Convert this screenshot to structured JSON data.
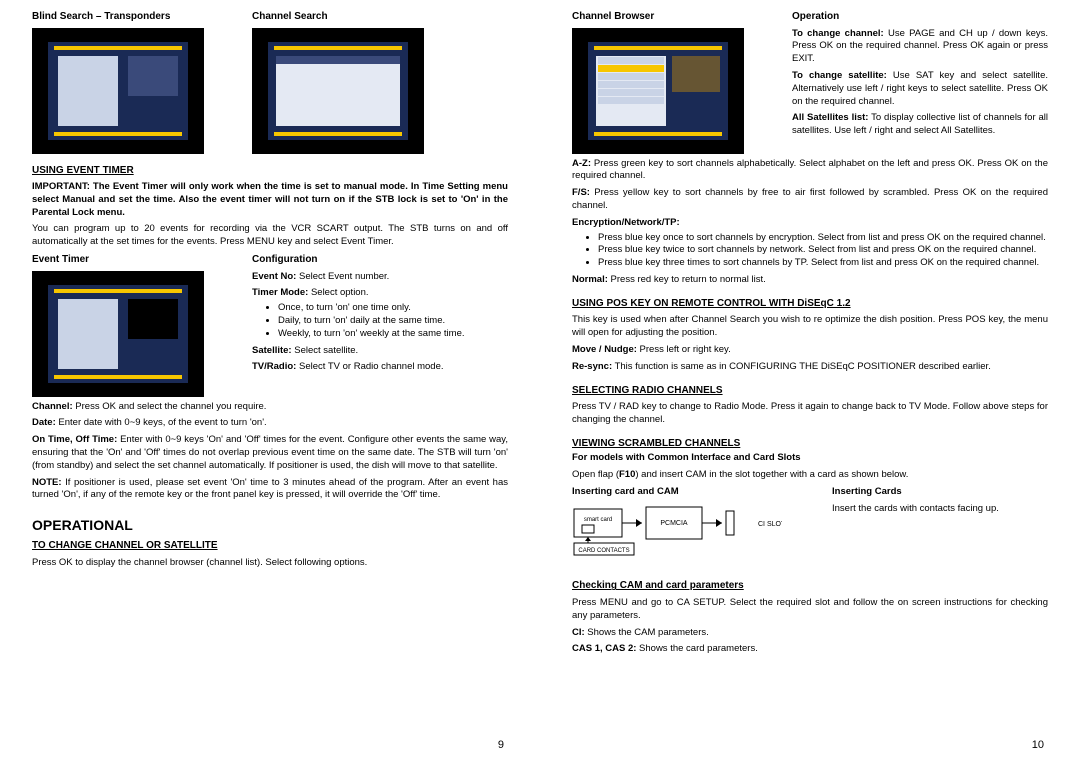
{
  "left": {
    "h_blind": "Blind Search – Transponders",
    "h_chsearch": "Channel Search",
    "using_event_timer": "USING EVENT TIMER",
    "important": "IMPORTANT: The Event Timer will only work when the time is set to manual mode. In Time Setting menu select Manual and set the time. Also the event timer will not turn on if the STB lock is set to 'On' in the Parental Lock menu.",
    "program_intro": "You can program up to 20 events for recording via the VCR SCART output. The STB turns on and off automatically at the set times for the events. Press MENU key and select Event Timer.",
    "h_event_timer": "Event Timer",
    "h_config": "Configuration",
    "cfg_event_no_b": "Event No:",
    "cfg_event_no": " Select Event number.",
    "cfg_timer_mode_b": "Timer Mode:",
    "cfg_timer_mode": " Select option.",
    "cfg_once": "Once, to turn 'on' one time only.",
    "cfg_daily": "Daily, to turn 'on' daily at the same time.",
    "cfg_weekly": "Weekly, to turn 'on' weekly at the same time.",
    "cfg_sat_b": "Satellite:",
    "cfg_sat": " Select satellite.",
    "cfg_tvr_b": "TV/Radio:",
    "cfg_tvr": " Select TV or Radio channel mode.",
    "channel_b": "Channel:",
    "channel": " Press OK and select the channel you require.",
    "date_b": "Date:",
    "date": " Enter date with 0~9 keys, of the event to turn 'on'.",
    "onoff_b": "On Time, Off Time:",
    "onoff": " Enter with 0~9 keys 'On' and 'Off' times for the event. Configure other events the same way, ensuring that the 'On' and 'Off' times do not overlap previous event time on the same date. The STB will turn 'on' (from standby) and select the set channel automatically. If positioner is used, the dish will move to that satellite.",
    "note_b": "NOTE:",
    "note": " If positioner is used, please set event 'On' time to 3 minutes ahead of the program. After an event has turned 'On', if any of the remote key or the front panel key is pressed, it will override the 'Off' time.",
    "operational": "OPERATIONAL",
    "to_change_h": "TO CHANGE CHANNEL OR SATELLITE",
    "to_change": "Press OK to display the channel browser (channel list). Select following options.",
    "page": "9"
  },
  "right": {
    "h_browser": "Channel Browser",
    "h_operation": "Operation",
    "op_change_ch_b": "To change channel:",
    "op_change_ch": " Use PAGE and CH up / down keys. Press OK on the required channel. Press OK again or press EXIT.",
    "op_change_sat_b": "To change satellite:",
    "op_change_sat": " Use SAT key and select satellite. Alternatively use left / right keys to select satellite. Press OK on the required channel.",
    "op_allsat_b": "All Satellites list:",
    "op_allsat": " To display collective list of channels for all satellites. Use left / right and select All Satellites.",
    "az_b": "A-Z:",
    "az": " Press green key to sort channels alphabetically. Select alphabet on the left and press OK.  Press OK on the required channel.",
    "fs_b": "F/S:",
    "fs": " Press yellow key to sort channels by free to air first followed by scrambled. Press OK on the required channel.",
    "enc_h": "Encryption/Network/TP:",
    "enc_1": "Press blue key once to sort channels by encryption. Select from list and press OK on the required channel.",
    "enc_2": "Press blue key twice to sort channels by network. Select from list and press OK on the required channel.",
    "enc_3": "Press blue key three times to sort channels by TP. Select from list and press OK on the required channel.",
    "normal_b": "Normal:",
    "normal": " Press red key to return to normal list.",
    "pos_h": "USING POS KEY ON REMOTE CONTROL WITH DiSEqC 1.2",
    "pos_txt": "This key is used when after Channel Search you wish to re optimize the dish position. Press POS key, the menu will open for adjusting the position.",
    "move_b": "Move / Nudge:",
    "move": "  Press left or right key.",
    "resync_b": "Re-sync:",
    "resync": " This function is same as in CONFIGURING THE DiSEqC  POSITIONER described earlier.",
    "radio_h": "SELECTING RADIO CHANNELS",
    "radio": "Press TV / RAD key to change to Radio Mode. Press it again to change back to TV Mode. Follow above steps for changing the channel.",
    "scr_h": "VIEWING SCRAMBLED CHANNELS",
    "scr_sub": "For models with Common Interface and Card Slots",
    "scr_txt_a": "Open flap (",
    "scr_txt_b": "F10",
    "scr_txt_c": ") and insert CAM in the slot together with a card as shown below.",
    "ins_cam_h": "Inserting card and CAM",
    "ins_cards_h": "Inserting Cards",
    "ins_cards": "Insert the cards with contacts facing up.",
    "check_h": "Checking CAM and card parameters",
    "check_txt": "Press MENU and go to CA SETUP. Select the required slot and follow the on screen instructions for checking any parameters.",
    "ci_b": "CI:",
    "ci": " Shows the CAM parameters.",
    "cas_b": "CAS 1, CAS 2:",
    "cas": " Shows the card parameters.",
    "page": "10",
    "diagram": {
      "smart_card": "smart card",
      "pcmcia": "PCMCIA",
      "ci_slot": "CI SLOT",
      "card_contacts": "CARD CONTACTS"
    }
  }
}
